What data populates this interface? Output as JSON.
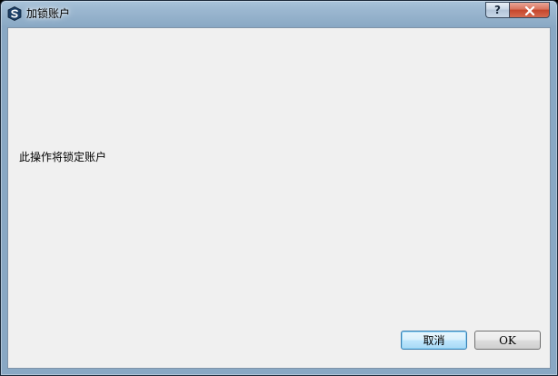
{
  "window": {
    "title": "加锁账户",
    "help_label": "?"
  },
  "dialog": {
    "message": "此操作将锁定账户"
  },
  "buttons": {
    "cancel_label": "取消",
    "ok_label": "OK"
  },
  "icons": {
    "app": "app-logo-icon",
    "help": "question-icon",
    "close": "close-icon"
  },
  "colors": {
    "title_bar": "#9bb7d0",
    "client_bg": "#f0f0f0",
    "close_button": "#c5452b",
    "default_button_border": "#3c7fb1"
  }
}
